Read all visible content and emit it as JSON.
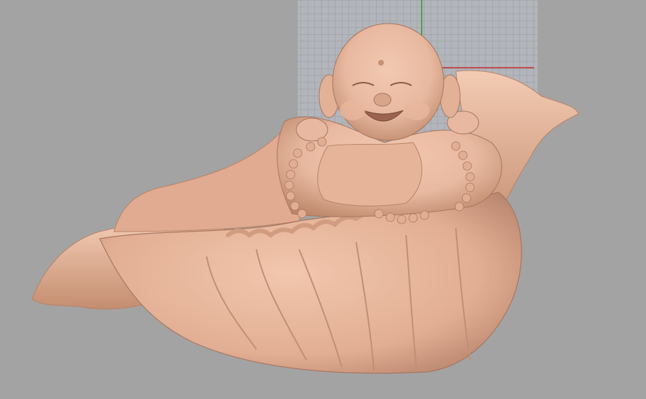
{
  "viewport": {
    "background_color": "#a3a3a3",
    "grid_color": "#8f8f8f",
    "grid_background": "#b2b5bb",
    "x_axis_color": "#c23030",
    "y_axis_color": "#2f9a2f"
  },
  "model": {
    "subject_icon": "laughing-buddha-in-lotus-leaf-sculpture",
    "material_color": "#e8b9a0",
    "shadow_color": "#b98366"
  }
}
